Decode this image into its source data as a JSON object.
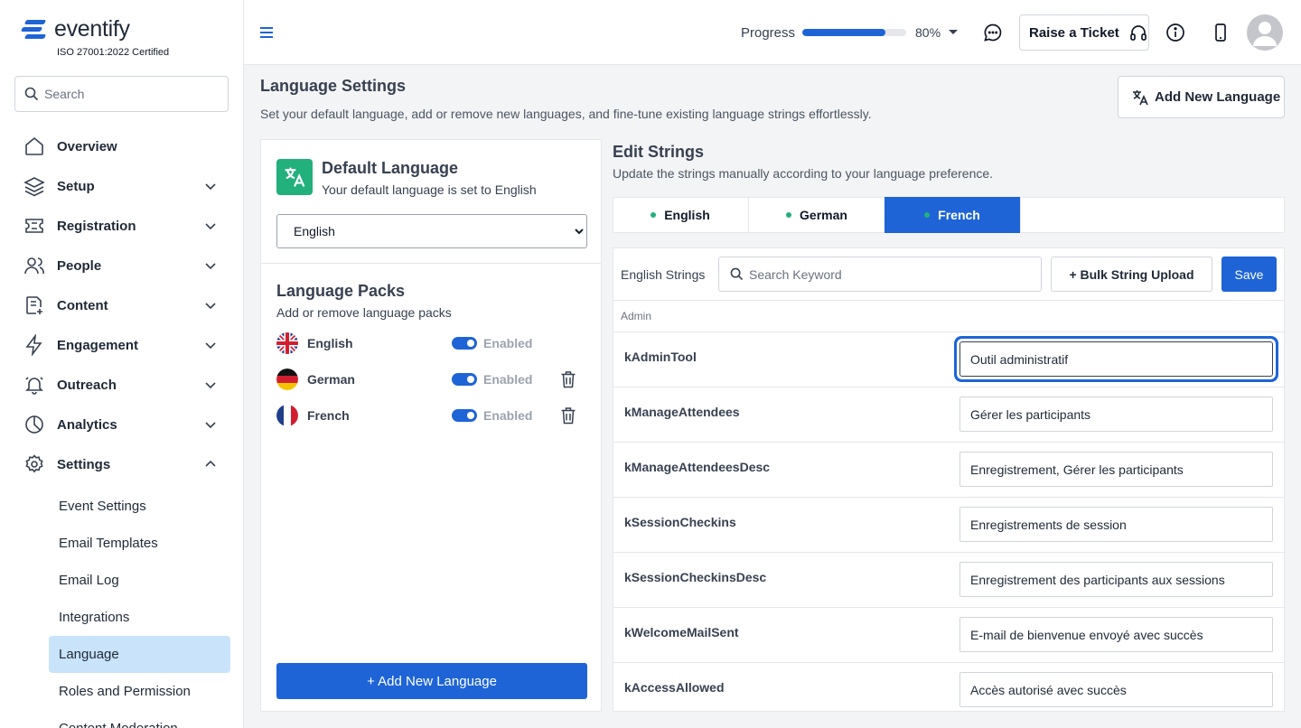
{
  "brand": {
    "name": "eventify",
    "tagline": "ISO 27001:2022 Certified",
    "accent_color": "#1e64d6",
    "success_color": "#22b07d"
  },
  "sidebar": {
    "search_placeholder": "Search",
    "items": [
      {
        "label": "Overview",
        "icon": "home-icon",
        "expandable": false
      },
      {
        "label": "Setup",
        "icon": "layers-icon",
        "expandable": true
      },
      {
        "label": "Registration",
        "icon": "ticket-icon",
        "expandable": true
      },
      {
        "label": "People",
        "icon": "users-icon",
        "expandable": true
      },
      {
        "label": "Content",
        "icon": "document-add-icon",
        "expandable": true
      },
      {
        "label": "Engagement",
        "icon": "lightning-icon",
        "expandable": true
      },
      {
        "label": "Outreach",
        "icon": "bell-icon",
        "expandable": true
      },
      {
        "label": "Analytics",
        "icon": "pie-chart-icon",
        "expandable": true
      },
      {
        "label": "Settings",
        "icon": "gear-icon",
        "expandable": true,
        "expanded": true
      }
    ],
    "settings_subitems": [
      {
        "label": "Event Settings",
        "active": false
      },
      {
        "label": "Email Templates",
        "active": false
      },
      {
        "label": "Email Log",
        "active": false
      },
      {
        "label": "Integrations",
        "active": false
      },
      {
        "label": "Language",
        "active": true
      },
      {
        "label": "Roles and Permission",
        "active": false
      },
      {
        "label": "Content Moderation",
        "active": false
      }
    ]
  },
  "topbar": {
    "progress_label": "Progress",
    "progress_fraction": 0.8,
    "progress_value": "80%",
    "ticket_label": "Raise a Ticket"
  },
  "page": {
    "title": "Language Settings",
    "description": "Set your default language, add or remove new languages, and fine-tune existing language strings effortlessly.",
    "add_language_label": "Add New Language"
  },
  "default_language": {
    "title": "Default Language",
    "description": "Your default language is set to English",
    "selected": "English",
    "options": [
      "English"
    ]
  },
  "language_packs": {
    "title": "Language Packs",
    "description": "Add or remove language packs",
    "packs": [
      {
        "name": "English",
        "status": "Enabled",
        "flag": "uk-flag-icon",
        "deletable": false
      },
      {
        "name": "German",
        "status": "Enabled",
        "flag": "germany-flag-icon",
        "deletable": true
      },
      {
        "name": "French",
        "status": "Enabled",
        "flag": "france-flag-icon",
        "deletable": true
      }
    ],
    "add_button_label": "+ Add New Language"
  },
  "edit_strings": {
    "title": "Edit Strings",
    "description": "Update the strings manually according to your language preference.",
    "tabs": [
      {
        "label": "English",
        "active": false
      },
      {
        "label": "German",
        "active": false
      },
      {
        "label": "French",
        "active": true
      }
    ],
    "toolbar_label": "English Strings",
    "search_placeholder": "Search Keyword",
    "bulk_upload_label": "+ Bulk String Upload",
    "save_label": "Save",
    "section": "Admin",
    "rows": [
      {
        "key": "kAdminTool",
        "value": "Outil administratif",
        "focused": true
      },
      {
        "key": "kManageAttendees",
        "value": "Gérer les participants",
        "focused": false
      },
      {
        "key": "kManageAttendeesDesc",
        "value": "Enregistrement, Gérer les participants",
        "focused": false
      },
      {
        "key": "kSessionCheckins",
        "value": "Enregistrements de session",
        "focused": false
      },
      {
        "key": "kSessionCheckinsDesc",
        "value": "Enregistrement des participants aux sessions",
        "focused": false
      },
      {
        "key": "kWelcomeMailSent",
        "value": "E-mail de bienvenue envoyé avec succès",
        "focused": false
      },
      {
        "key": "kAccessAllowed",
        "value": "Accès autorisé avec succès",
        "focused": false
      }
    ]
  }
}
